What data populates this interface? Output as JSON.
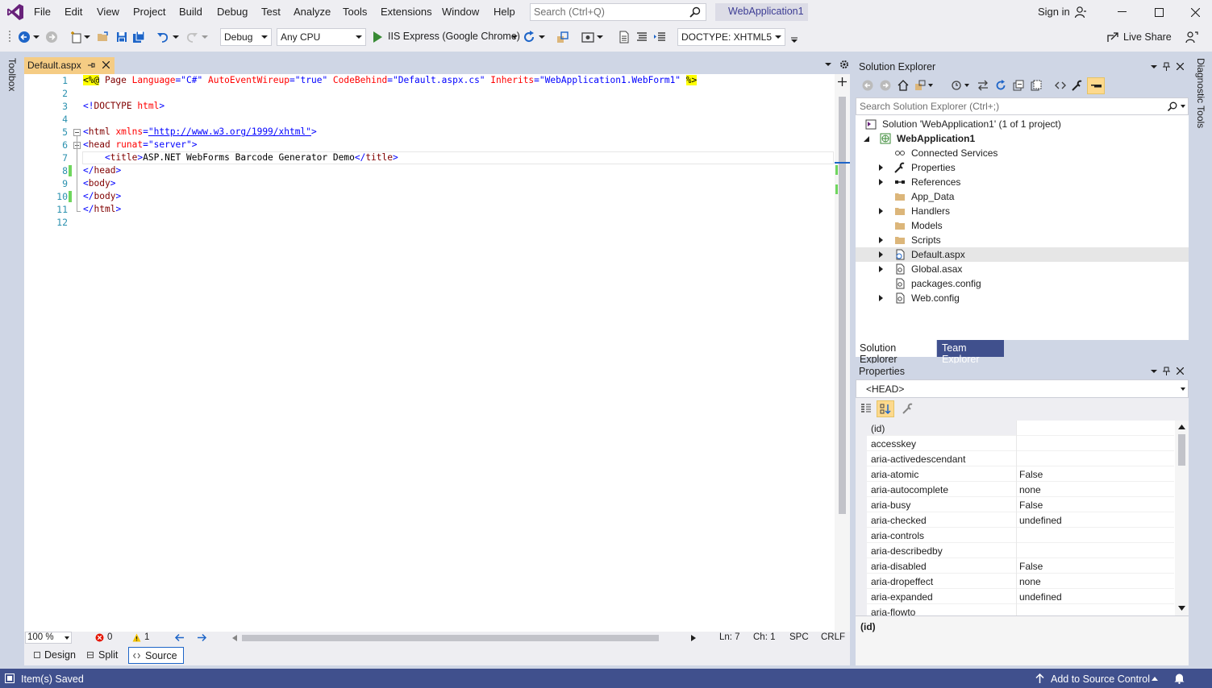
{
  "menu": {
    "items": [
      "File",
      "Edit",
      "View",
      "Project",
      "Build",
      "Debug",
      "Test",
      "Analyze",
      "Tools",
      "Extensions",
      "Window",
      "Help"
    ],
    "search_placeholder": "Search (Ctrl+Q)",
    "solution_name": "WebApplication1",
    "sign_in": "Sign in"
  },
  "toolbar": {
    "config": "Debug",
    "platform": "Any CPU",
    "run_target": "IIS Express (Google Chrome)",
    "doctype": "DOCTYPE: XHTML5",
    "live_share": "Live Share"
  },
  "side": {
    "left": "Toolbox",
    "right": "Diagnostic Tools"
  },
  "editor": {
    "tab_title": "Default.aspx",
    "line_numbers": [
      "1",
      "2",
      "3",
      "4",
      "5",
      "6",
      "7",
      "8",
      "9",
      "10",
      "11",
      "12"
    ],
    "zoom": "100 %",
    "errors": "0",
    "warnings": "1",
    "ln": "Ln: 7",
    "ch": "Ch: 1",
    "spc": "SPC",
    "crlf": "CRLF",
    "view_tabs": [
      "Design",
      "Split",
      "Source"
    ],
    "code": {
      "l1": {
        "open": "<%@",
        "directive": " Page ",
        "a1": "Language",
        "v1": "\"C#\"",
        "a2": " AutoEventWireup",
        "v2": "\"true\"",
        "a3": " CodeBehind",
        "v3": "\"Default.aspx.cs\"",
        "a4": " Inherits",
        "v4": "\"WebApplication1.WebForm1\"",
        "close": "%>"
      },
      "l3": {
        "lt": "<!",
        "tag": "DOCTYPE",
        "attr": " html",
        "gt": ">"
      },
      "l5": {
        "lt": "<",
        "tag": "html",
        "attr": " xmlns",
        "eq": "=",
        "link": "\"http://www.w3.org/1999/xhtml\"",
        "gt": ">"
      },
      "l6": {
        "lt": "<",
        "tag": "head",
        "attr": " runat",
        "eq": "=",
        "val": "\"server\"",
        "gt": ">"
      },
      "l7": {
        "indent": "    ",
        "lt": "<",
        "tag": "title",
        "gt": ">",
        "text": "ASP.NET WebForms Barcode Generator Demo",
        "clt": "</",
        "ctag": "title",
        "cgt": ">"
      },
      "l8": {
        "lt": "</",
        "tag": "head",
        "gt": ">"
      },
      "l9": {
        "lt": "<",
        "tag": "body",
        "gt": ">"
      },
      "l10": {
        "lt": "</",
        "tag": "body",
        "gt": ">"
      },
      "l11": {
        "lt": "</",
        "tag": "html",
        "gt": ">"
      }
    }
  },
  "solution_explorer": {
    "title": "Solution Explorer",
    "search_placeholder": "Search Solution Explorer (Ctrl+;)",
    "solution": "Solution 'WebApplication1' (1 of 1 project)",
    "project": "WebApplication1",
    "items": [
      {
        "label": "Connected Services",
        "expandable": false,
        "icon": "connected-services-icon"
      },
      {
        "label": "Properties",
        "expandable": true,
        "icon": "wrench-icon"
      },
      {
        "label": "References",
        "expandable": true,
        "icon": "references-icon"
      },
      {
        "label": "App_Data",
        "expandable": false,
        "icon": "folder-icon"
      },
      {
        "label": "Handlers",
        "expandable": true,
        "icon": "folder-icon"
      },
      {
        "label": "Models",
        "expandable": false,
        "icon": "folder-icon"
      },
      {
        "label": "Scripts",
        "expandable": true,
        "icon": "folder-icon"
      },
      {
        "label": "Default.aspx",
        "expandable": true,
        "icon": "aspx-file-icon",
        "selected": true
      },
      {
        "label": "Global.asax",
        "expandable": true,
        "icon": "config-file-icon"
      },
      {
        "label": "packages.config",
        "expandable": false,
        "icon": "config-file-icon"
      },
      {
        "label": "Web.config",
        "expandable": true,
        "icon": "config-file-icon"
      }
    ],
    "tabs": [
      "Solution Explorer",
      "Team Explorer"
    ]
  },
  "properties": {
    "title": "Properties",
    "object": "<HEAD>",
    "rows": [
      {
        "name": "(id)",
        "value": ""
      },
      {
        "name": "accesskey",
        "value": ""
      },
      {
        "name": "aria-activedescendant",
        "value": ""
      },
      {
        "name": "aria-atomic",
        "value": "False"
      },
      {
        "name": "aria-autocomplete",
        "value": "none"
      },
      {
        "name": "aria-busy",
        "value": "False"
      },
      {
        "name": "aria-checked",
        "value": "undefined"
      },
      {
        "name": "aria-controls",
        "value": ""
      },
      {
        "name": "aria-describedby",
        "value": ""
      },
      {
        "name": "aria-disabled",
        "value": "False"
      },
      {
        "name": "aria-dropeffect",
        "value": "none"
      },
      {
        "name": "aria-expanded",
        "value": "undefined"
      },
      {
        "name": "aria-flowto",
        "value": ""
      }
    ],
    "description_title": "(id)"
  },
  "status": {
    "message": "Item(s) Saved",
    "source_control": "Add to Source Control"
  },
  "colors": {
    "accent": "#68217a",
    "status_bar": "#40508d",
    "doc_tab": "#f5cc84"
  }
}
